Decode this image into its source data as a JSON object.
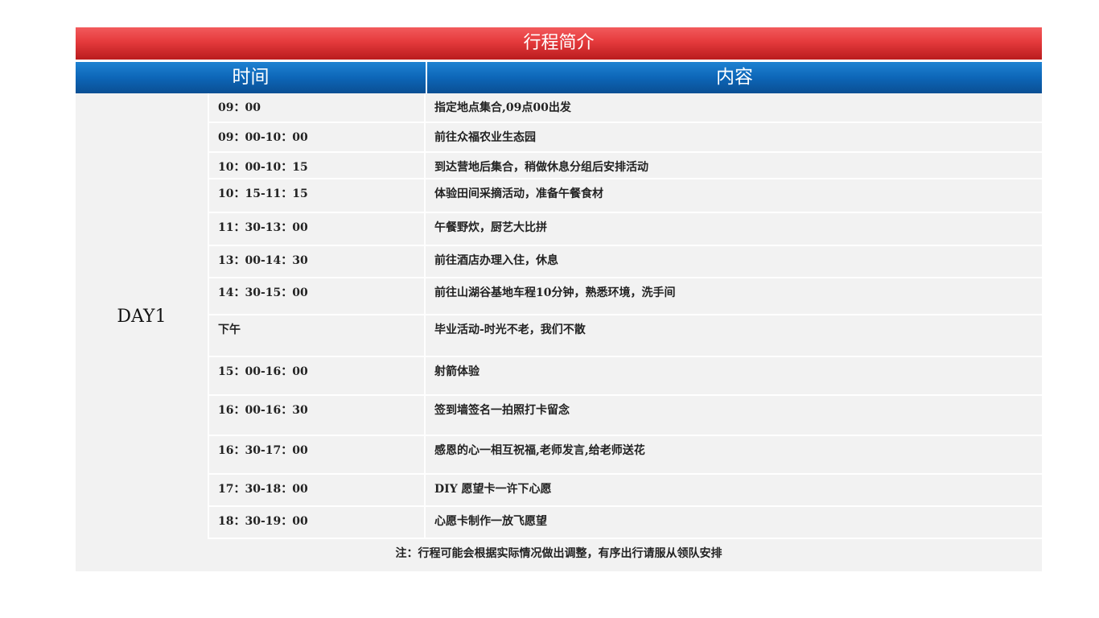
{
  "title": "行程简介",
  "headers": {
    "time": "时间",
    "content": "内容"
  },
  "day_label": "DAY1",
  "rows": [
    {
      "time": "09：00",
      "content": "指定地点集合,09点00出发"
    },
    {
      "time": "09：00-10：00",
      "content": "前往众福农业生态园"
    },
    {
      "time": "10：00-10：15",
      "content": "到达营地后集合，稍做休息分组后安排活动"
    },
    {
      "time": "10：15-11：15",
      "content": "体验田间采摘活动，准备午餐食材"
    },
    {
      "time": "11：30-13：00",
      "content": "午餐野炊，厨艺大比拼"
    },
    {
      "time": "13：00-14：30",
      "content": "前往酒店办理入住，休息"
    },
    {
      "time": "14：30-15：00",
      "content": "前往山湖谷基地车程10分钟，熟悉环境，洗手间"
    },
    {
      "time": "下午",
      "content": "毕业活动-时光不老，我们不散"
    },
    {
      "time": "15：00-16：00",
      "content": "射箭体验"
    },
    {
      "time": "16：00-16：30",
      "content": "签到墙签名一拍照打卡留念"
    },
    {
      "time": "16：30-17：00",
      "content": "感恩的心一相互祝福,老师发言,给老师送花"
    },
    {
      "time": "17：30-18：00",
      "content": "DIY 愿望卡一许下心愿"
    },
    {
      "time": "18：30-19：00",
      "content": "心愿卡制作一放飞愿望"
    }
  ],
  "footer_note": "注：行程可能会根据实际情况做出调整，有序出行请服从领队安排",
  "colors": {
    "title_red": "#e53a3c",
    "header_blue": "#0d66b8",
    "row_gray": "#f2f2f2"
  }
}
